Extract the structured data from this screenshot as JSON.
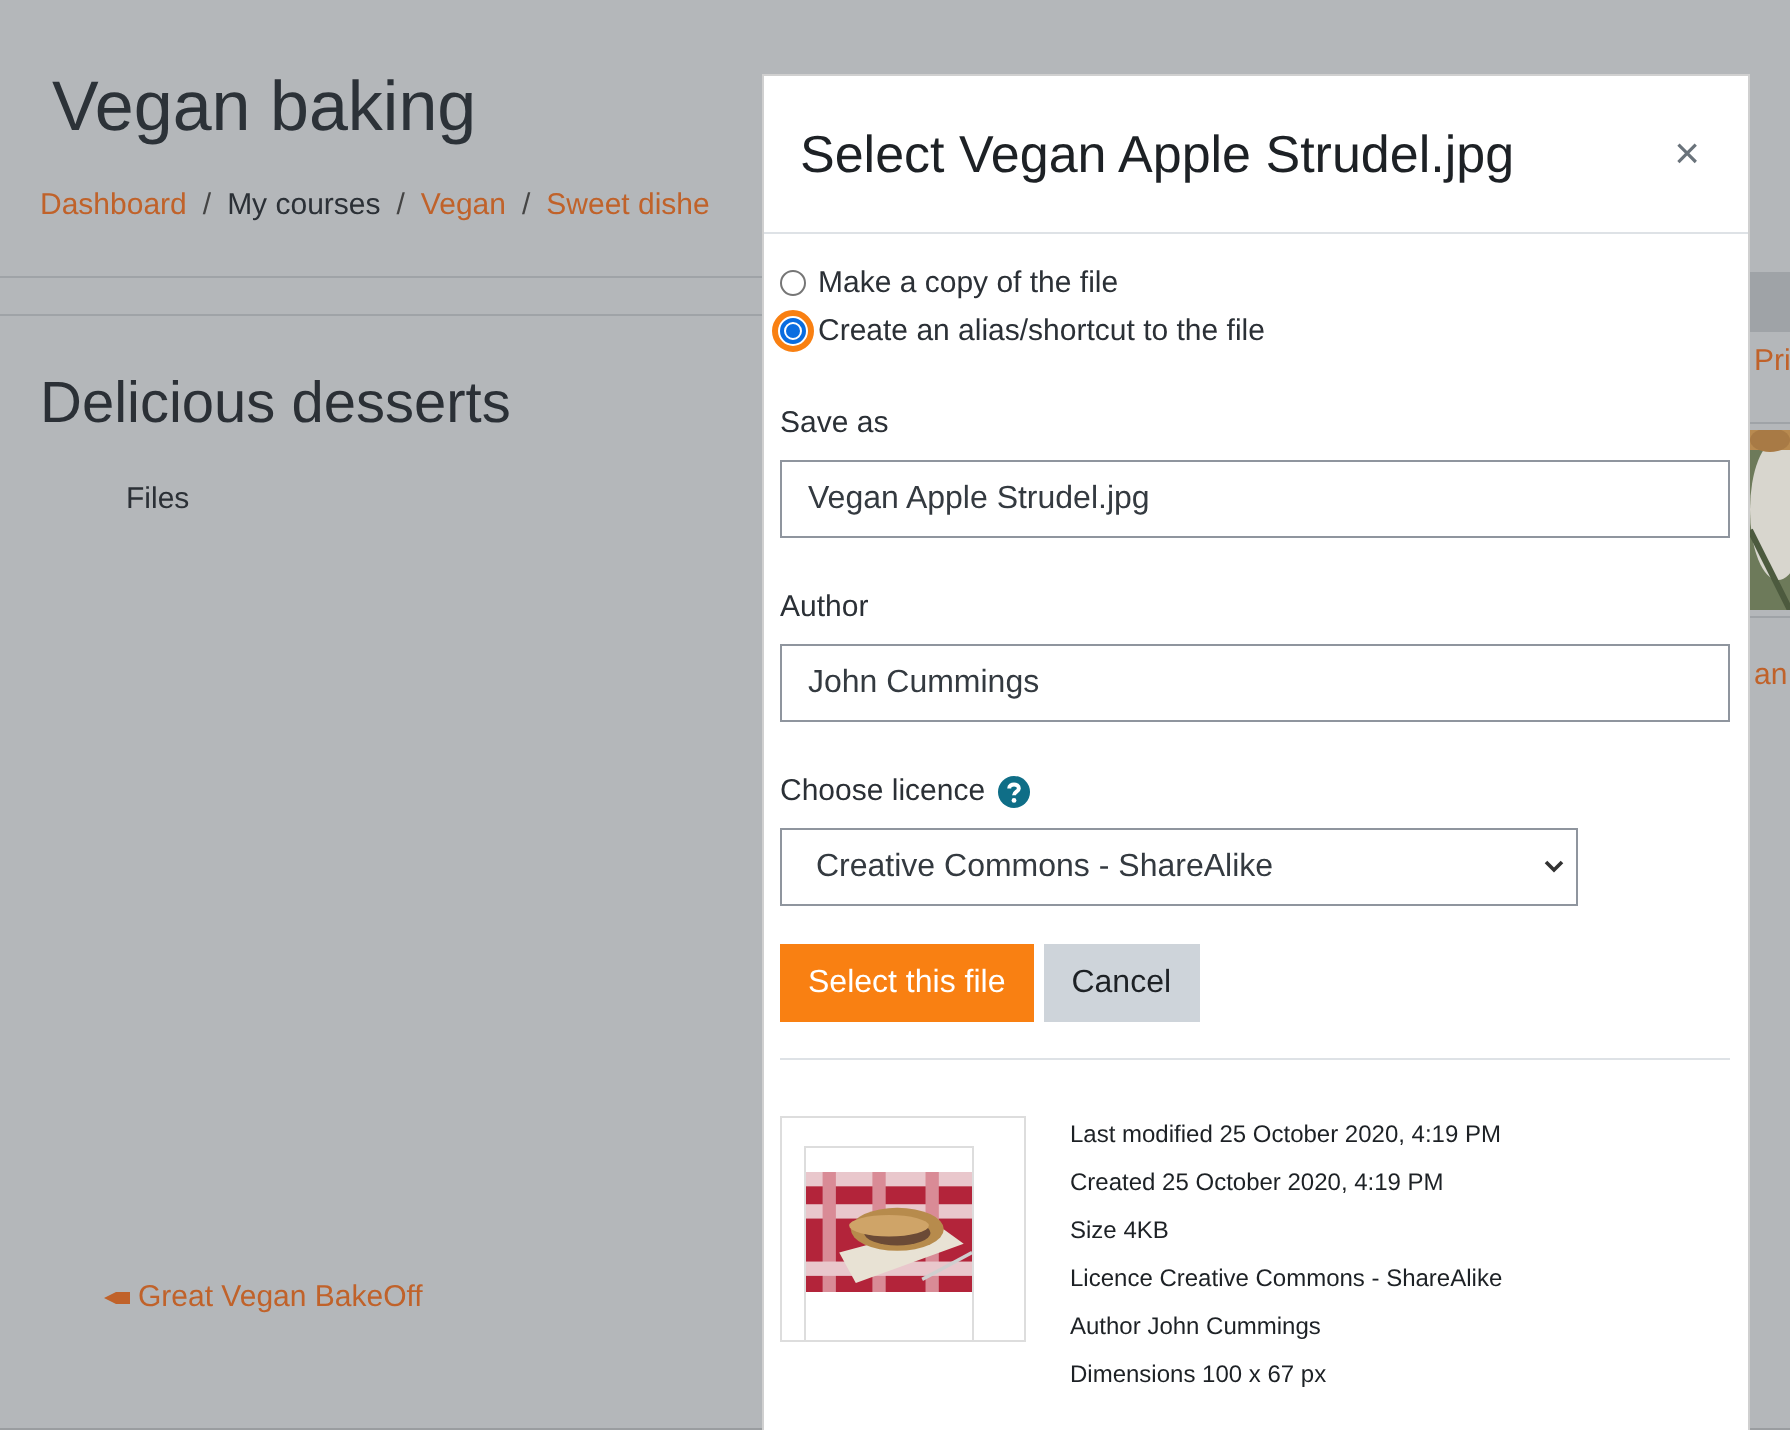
{
  "page": {
    "title": "Vegan baking",
    "breadcrumb": [
      {
        "label": "Dashboard",
        "link": true
      },
      {
        "label": "My courses",
        "link": false
      },
      {
        "label": "Vegan",
        "link": true
      },
      {
        "label": "Sweet dishe",
        "link": true
      }
    ],
    "breadcrumb_separator": "/",
    "section_title": "Delicious desserts",
    "files_label": "Files",
    "previous_link": "Great Vegan BakeOff",
    "right_strip": {
      "link_1": "Pri",
      "link_2": "an"
    }
  },
  "dialog": {
    "title": "Select Vegan Apple Strudel.jpg",
    "close": "×",
    "options": [
      {
        "label": "Make a copy of the file",
        "selected": false
      },
      {
        "label": "Create an alias/shortcut to the file",
        "selected": true
      }
    ],
    "save_as": {
      "label": "Save as",
      "value": "Vegan Apple Strudel.jpg"
    },
    "author": {
      "label": "Author",
      "value": "John Cummings"
    },
    "licence": {
      "label": "Choose licence",
      "value": "Creative Commons - ShareAlike"
    },
    "buttons": [
      {
        "label": "Select this file",
        "kind": "primary"
      },
      {
        "label": "Cancel",
        "kind": "secondary"
      }
    ],
    "details": [
      {
        "label": "Last modified",
        "value": "25 October 2020, 4:19 PM"
      },
      {
        "label": "Created",
        "value": "25 October 2020, 4:19 PM"
      },
      {
        "label": "Size",
        "value": "4KB"
      },
      {
        "label": "Licence",
        "value": "Creative Commons - ShareAlike"
      },
      {
        "label": "Author",
        "value": "John Cummings"
      },
      {
        "label": "Dimensions",
        "value": "100 x 67 px"
      }
    ]
  }
}
